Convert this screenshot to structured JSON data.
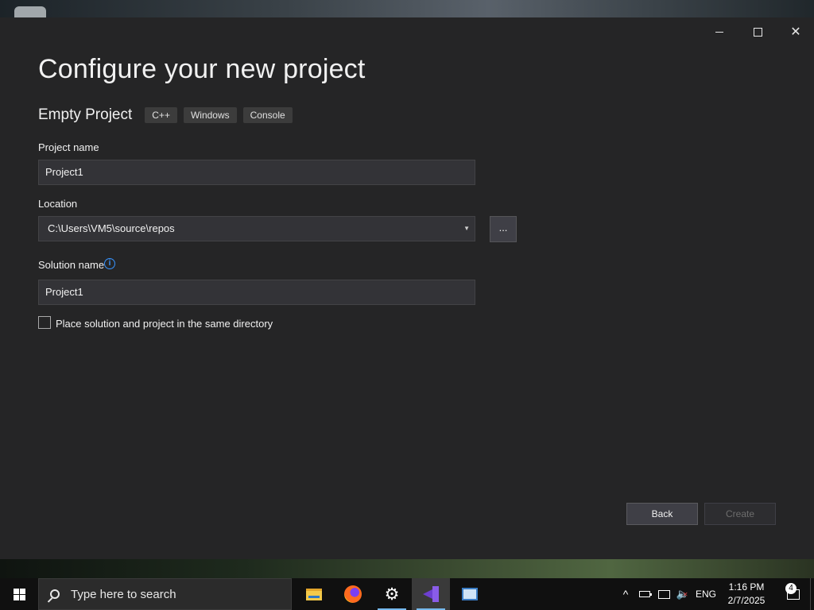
{
  "window": {
    "title": "Configure your new project",
    "controls": {
      "minimize": "minimize",
      "maximize": "maximize",
      "close": "✕"
    }
  },
  "template": {
    "name": "Empty Project",
    "tags": [
      "C++",
      "Windows",
      "Console"
    ]
  },
  "form": {
    "project_name_label": "Project name",
    "project_name_value": "Project1",
    "location_label": "Location",
    "location_value": "C:\\Users\\VM5\\source\\repos",
    "browse_label": "...",
    "solution_name_label": "Solution name",
    "solution_name_value": "Project1",
    "info_icon": "i",
    "same_dir_label": "Place solution and project in the same directory",
    "same_dir_checked": false
  },
  "buttons": {
    "back": "Back",
    "create": "Create"
  },
  "taskbar": {
    "search_placeholder": "Type here to search",
    "apps": [
      "file-explorer",
      "firefox",
      "settings",
      "visual-studio",
      "remote-desktop"
    ],
    "tray": {
      "chevron": "^",
      "language": "ENG",
      "time": "1:16 PM",
      "date": "2/7/2025",
      "notification_count": "4"
    }
  },
  "colors": {
    "window_bg": "#252526",
    "field_bg": "#333337",
    "accent": "#3794ff",
    "taskbar_bg": "#101010"
  }
}
